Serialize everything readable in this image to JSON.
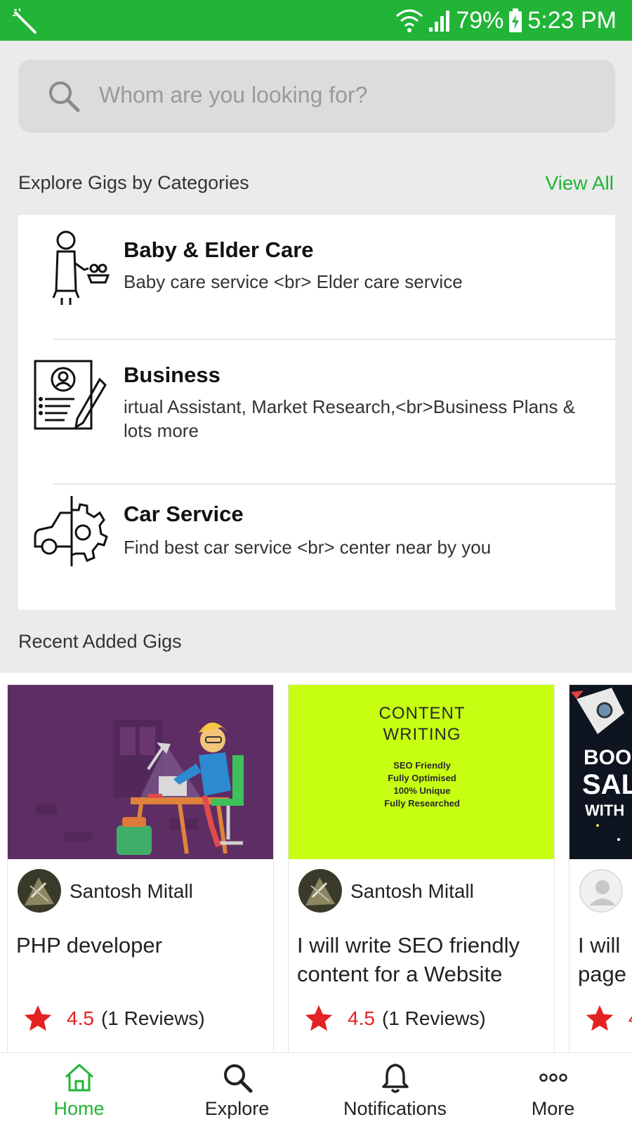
{
  "status_bar": {
    "battery": "79%",
    "time": "5:23 PM"
  },
  "search": {
    "placeholder": "Whom are you looking for?"
  },
  "categories_section": {
    "title": "Explore Gigs by Categories",
    "view_all": "View All"
  },
  "categories": [
    {
      "name": "Baby & Elder Care",
      "description": "Baby care service <br> Elder care service",
      "icon": "baby-elder-care-icon"
    },
    {
      "name": "Business",
      "description": "irtual Assistant, Market Research,<br>Business Plans & lots more",
      "icon": "business-icon"
    },
    {
      "name": "Car Service",
      "description": "Find best car service <br> center near by you",
      "icon": "car-service-icon"
    }
  ],
  "recent_section": {
    "title": "Recent Added Gigs"
  },
  "gigs": [
    {
      "author": "Santosh Mitall",
      "title": "PHP developer",
      "rating": "4.5",
      "reviews": "(1 Reviews)"
    },
    {
      "author": "Santosh Mitall",
      "title": "I will write SEO friendly content for a Website",
      "rating": "4.5",
      "reviews": "(1 Reviews)",
      "thumb_heading_1": "CONTENT",
      "thumb_heading_2": "WRITING",
      "thumb_lines": [
        "SEO Friendly",
        "Fully Optimised",
        "100% Unique",
        "Fully Researched"
      ]
    },
    {
      "title_fragment_1": "I will",
      "title_fragment_2": "page",
      "rating": "4",
      "thumb_text_1": "BOO",
      "thumb_text_2": "SAL",
      "thumb_text_3": "WITH"
    }
  ],
  "bottom_nav": [
    {
      "label": "Home",
      "icon": "home-icon",
      "active": true
    },
    {
      "label": "Explore",
      "icon": "search-icon",
      "active": false
    },
    {
      "label": "Notifications",
      "icon": "bell-icon",
      "active": false
    },
    {
      "label": "More",
      "icon": "more-dots-icon",
      "active": false
    }
  ],
  "colors": {
    "primary_green": "#21b436",
    "rating_red": "#e32222",
    "background": "#ebebeb"
  }
}
